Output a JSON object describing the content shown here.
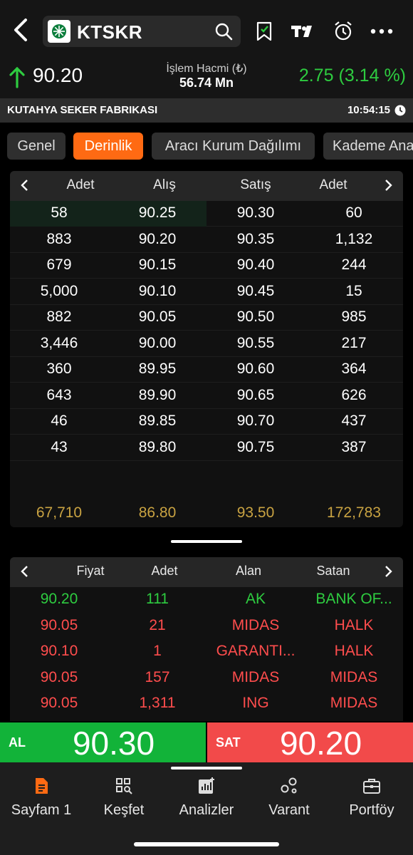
{
  "header": {
    "symbol": "KTSKR"
  },
  "price_bar": {
    "last_price": "90.20",
    "volume_label": "İşlem Hacmi (₺)",
    "volume_value": "56.74 Mn",
    "change": "2.75 (3.14 %)"
  },
  "company": {
    "name": "KUTAHYA SEKER FABRIKASI",
    "time": "10:54:15"
  },
  "tabs": [
    {
      "label": "Genel"
    },
    {
      "label": "Derinlik"
    },
    {
      "label": "Aracı Kurum Dağılımı"
    },
    {
      "label": "Kademe Analizi"
    }
  ],
  "depth": {
    "headers": [
      "Adet",
      "Alış",
      "Satış",
      "Adet"
    ],
    "rows": [
      [
        "58",
        "90.25",
        "90.30",
        "60"
      ],
      [
        "883",
        "90.20",
        "90.35",
        "1,132"
      ],
      [
        "679",
        "90.15",
        "90.40",
        "244"
      ],
      [
        "5,000",
        "90.10",
        "90.45",
        "15"
      ],
      [
        "882",
        "90.05",
        "90.50",
        "985"
      ],
      [
        "3,446",
        "90.00",
        "90.55",
        "217"
      ],
      [
        "360",
        "89.95",
        "90.60",
        "364"
      ],
      [
        "643",
        "89.90",
        "90.65",
        "626"
      ],
      [
        "46",
        "89.85",
        "90.70",
        "437"
      ],
      [
        "43",
        "89.80",
        "90.75",
        "387"
      ]
    ],
    "totals": [
      "67,710",
      "86.80",
      "93.50",
      "172,783"
    ]
  },
  "trades": {
    "headers": [
      "Fiyat",
      "Adet",
      "Alan",
      "Satan"
    ],
    "rows": [
      [
        "90.20",
        "111",
        "AK",
        "BANK OF..."
      ],
      [
        "90.05",
        "21",
        "MIDAS",
        "HALK"
      ],
      [
        "90.10",
        "1",
        "GARANTI...",
        "HALK"
      ],
      [
        "90.05",
        "157",
        "MIDAS",
        "MIDAS"
      ],
      [
        "90.05",
        "1,311",
        "ING",
        "MIDAS"
      ]
    ],
    "row_colors": [
      "green",
      "red",
      "red",
      "red",
      "red"
    ]
  },
  "order_buttons": {
    "buy_label": "AL",
    "buy_price": "90.30",
    "sell_label": "SAT",
    "sell_price": "90.20"
  },
  "nav": [
    {
      "label": "Sayfam 1",
      "icon": "document-icon"
    },
    {
      "label": "Keşfet",
      "icon": "explore-icon"
    },
    {
      "label": "Analizler",
      "icon": "analysis-chart-icon"
    },
    {
      "label": "Varant",
      "icon": "warrant-icon"
    },
    {
      "label": "Portföy",
      "icon": "briefcase-icon"
    }
  ],
  "colors": {
    "accent": "#ff6a13",
    "up": "#2ecc40",
    "down": "#ff4d4d",
    "buy": "#12b339",
    "sell": "#f24a4a",
    "totals": "#c9a342"
  }
}
